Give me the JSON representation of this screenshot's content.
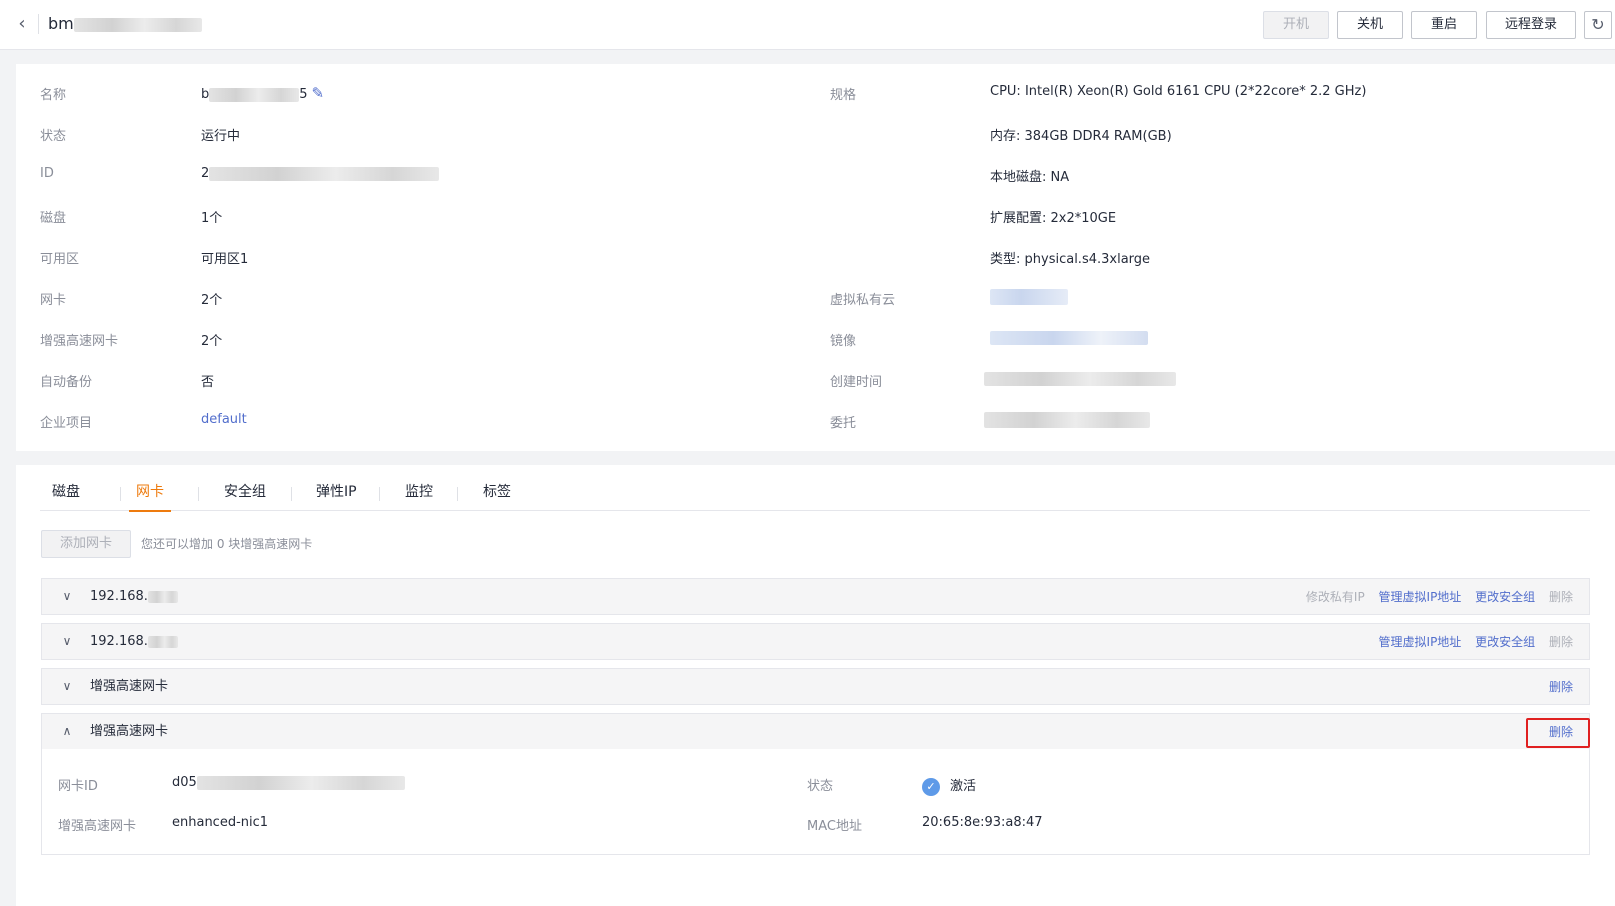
{
  "header": {
    "back_icon": "chevron-left-icon",
    "title": "bm",
    "buttons": {
      "start": "开机",
      "stop": "关机",
      "restart": "重启",
      "remote_login": "远程登录"
    },
    "refresh_icon": "refresh-icon"
  },
  "info": {
    "left": [
      {
        "label": "名称",
        "value": "b"
      },
      {
        "label": "状态",
        "value": "运行中"
      },
      {
        "label": "ID",
        "value": "2"
      },
      {
        "label": "磁盘",
        "value": "1个"
      },
      {
        "label": "可用区",
        "value": "可用区1"
      },
      {
        "label": "网卡",
        "value": "2个"
      },
      {
        "label": "增强高速网卡",
        "value": "2个"
      },
      {
        "label": "自动备份",
        "value": "否"
      },
      {
        "label": "企业项目",
        "value": "default"
      }
    ],
    "name_tail": "5",
    "edit_icon": "pencil-icon",
    "right": [
      {
        "label": "规格",
        "value": "CPU: Intel(R) Xeon(R) Gold 6161 CPU (2*22core* 2.2 GHz)"
      },
      {
        "label": "",
        "value": "内存: 384GB DDR4 RAM(GB)"
      },
      {
        "label": "",
        "value": "本地磁盘: NA"
      },
      {
        "label": "",
        "value": "扩展配置: 2x2*10GE"
      },
      {
        "label": "",
        "value": "类型: physical.s4.3xlarge"
      },
      {
        "label": "虚拟私有云",
        "value": ""
      },
      {
        "label": "镜像",
        "value": ""
      },
      {
        "label": "创建时间",
        "value": ""
      },
      {
        "label": "委托",
        "value": ""
      }
    ]
  },
  "tabs": [
    "磁盘",
    "网卡",
    "安全组",
    "弹性IP",
    "监控",
    "标签"
  ],
  "active_tab": "网卡",
  "nic": {
    "add_button": "添加网卡",
    "hint": "您还可以增加 0 块增强高速网卡",
    "items": [
      {
        "name": "192.168.",
        "ops_disabled_before": "修改私有IP",
        "ops_links": [
          "管理虚拟IP地址",
          "更改安全组"
        ],
        "ops_disabled_after": "删除"
      },
      {
        "name": "192.168.",
        "ops_disabled_before": "",
        "ops_links": [
          "管理虚拟IP地址",
          "更改安全组"
        ],
        "ops_disabled_after": "删除"
      },
      {
        "name": "增强高速网卡",
        "ops_links": [
          "删除"
        ]
      },
      {
        "name": "增强高速网卡",
        "ops_links": [
          "删除"
        ]
      }
    ],
    "detail": {
      "nic_id_label": "网卡ID",
      "nic_id_value": "d05",
      "enhanced_label": "增强高速网卡",
      "enhanced_value": "enhanced-nic1",
      "status_label": "状态",
      "status_value": "激活",
      "mac_label": "MAC地址",
      "mac_value": "20:65:8e:93:a8:47"
    }
  },
  "colors": {
    "accent": "#ee7b0e",
    "link": "#526ecc",
    "highlight": "#e02020"
  }
}
